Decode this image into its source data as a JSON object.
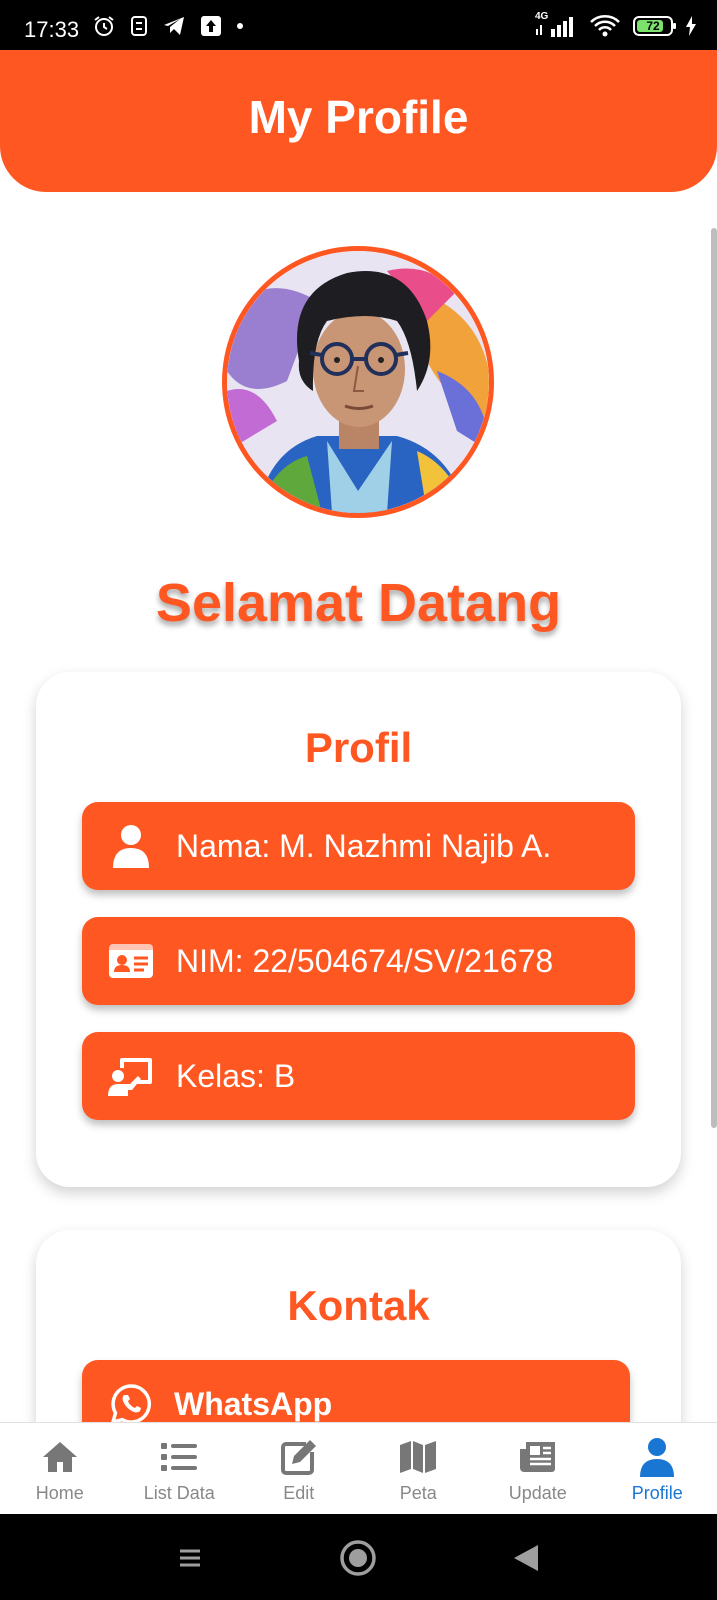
{
  "status": {
    "time": "17:33",
    "network": "4G",
    "battery": "72"
  },
  "header": {
    "title": "My Profile"
  },
  "welcome": "Selamat Datang",
  "profil": {
    "title": "Profil",
    "items": [
      {
        "icon": "person-icon",
        "text": "Nama: M. Nazhmi Najib A."
      },
      {
        "icon": "id-card-icon",
        "text": "NIM: 22/504674/SV/21678"
      },
      {
        "icon": "classroom-icon",
        "text": "Kelas: B"
      }
    ]
  },
  "kontak": {
    "title": "Kontak",
    "items": [
      {
        "icon": "whatsapp-icon",
        "text": "WhatsApp"
      }
    ]
  },
  "nav": {
    "items": [
      {
        "label": "Home",
        "icon": "home-icon"
      },
      {
        "label": "List Data",
        "icon": "list-icon"
      },
      {
        "label": "Edit",
        "icon": "edit-icon"
      },
      {
        "label": "Peta",
        "icon": "map-icon"
      },
      {
        "label": "Update",
        "icon": "newspaper-icon"
      },
      {
        "label": "Profile",
        "icon": "user-icon"
      }
    ],
    "active": "Profile"
  },
  "colors": {
    "accent": "#ff5722",
    "active_nav": "#1976d2",
    "inactive_nav": "#888888"
  }
}
